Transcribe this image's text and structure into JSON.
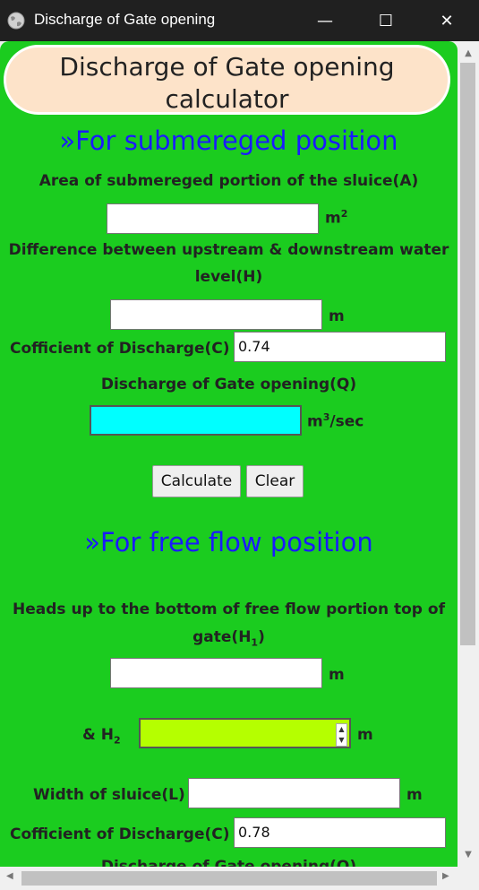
{
  "window": {
    "title": "Discharge of Gate opening",
    "minimize": "—",
    "maximize": "☐",
    "close": "✕"
  },
  "header": {
    "line1": "Discharge of Gate opening",
    "line2": "calculator"
  },
  "submerged": {
    "title": "»For submereged position",
    "area_label": "Area of submereged portion of the sluice(A)",
    "area_value": "",
    "area_unit": "m",
    "area_unit_sup": "2",
    "diff_label_line1": "Difference between upstream & downstream water",
    "diff_label_line2": "level(H)",
    "diff_value": "",
    "diff_unit": "m",
    "coef_label": "Cofficient of Discharge(C)",
    "coef_value": "0.74",
    "result_label": "Discharge of Gate opening(Q)",
    "result_value": "",
    "result_unit_pre": "m",
    "result_unit_sup": "3",
    "result_unit_post": "/sec",
    "calculate": "Calculate",
    "clear": "Clear"
  },
  "free": {
    "title": "»For free flow position",
    "heads_label_line1": "Heads up to the bottom of free flow portion top of",
    "heads_label_line2_pre": "gate(H",
    "heads_label_line2_sub": "1",
    "heads_label_line2_post": ")",
    "heads_value": "",
    "heads_unit": "m",
    "h2_label_pre": "& H",
    "h2_label_sub": "2",
    "h2_value": "",
    "h2_unit": "m",
    "width_label": "Width of sluice(L)",
    "width_value": "",
    "width_unit": "m",
    "coef_label": "Cofficient of Discharge(C)",
    "coef_value": "0.78",
    "result_label_partial": "Discharge of Gate opening(Q)"
  },
  "colors": {
    "page_bg": "#1bcc1f",
    "header_bg": "#fde3c9",
    "title_blue": "#1a1aff",
    "result_bg": "#00ffff",
    "h2_bg": "#b5ff00"
  }
}
